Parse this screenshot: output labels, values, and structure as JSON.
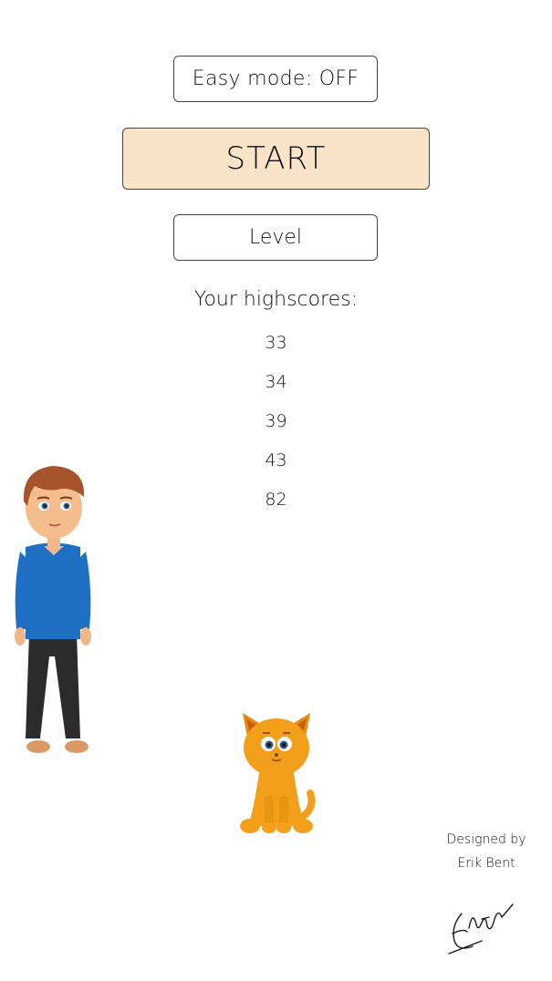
{
  "menu": {
    "easy_mode_label": "Easy mode: OFF",
    "start_label": "START",
    "level_label": "Level"
  },
  "highscores": {
    "title": "Your highscores:",
    "values": [
      "33",
      "34",
      "39",
      "43",
      "82"
    ]
  },
  "credits": {
    "line1": "Designed by",
    "line2": "Erik Bent"
  },
  "colors": {
    "start_button_bg": "#f9e4c8",
    "button_border": "#444444",
    "boy_shirt": "#1f6fc4",
    "boy_pants": "#2b2b2b",
    "boy_hair": "#a5532a",
    "cat_fur": "#f2a01c"
  },
  "characters": {
    "boy": "boy-character",
    "cat": "cat-character",
    "signature": "signature-graphic"
  }
}
